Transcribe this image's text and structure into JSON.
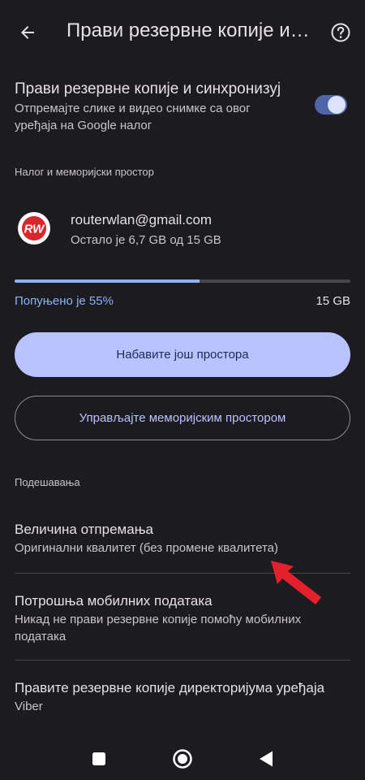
{
  "appbar": {
    "title": "Прави резервне копије и синхронизуј",
    "back_icon": "arrow-back-icon",
    "help_icon": "help-circle-icon"
  },
  "sync": {
    "title": "Прави резервне копије и синхронизуј",
    "description": "Отпремајте слике и видео снимке са овог уређаја на Google налог",
    "enabled": true
  },
  "account_section": {
    "header": "Налог и меморијски простор",
    "avatar_text": "RW",
    "email": "routerwlan@gmail.com",
    "storage_text": "Остало је 6,7 GB од 15 GB",
    "used_fraction": 0.55,
    "used_label": "Попуњено је 55%",
    "total_label": "15 GB"
  },
  "buttons": {
    "get_more": "Набавите још простора",
    "manage": "Управљајте меморијским простором"
  },
  "settings_section": {
    "header": "Подешавања",
    "items": [
      {
        "title": "Величина отпремања",
        "description": "Оригинални квалитет (без промене квалитета)"
      },
      {
        "title": "Потрошња мобилних података",
        "description": "Никад не прави резервне копије помоћу мобилних података"
      },
      {
        "title": "Правите резервне копије директоријума уређаја",
        "description": "Viber"
      }
    ]
  },
  "colors": {
    "accent": "#8ab4f8",
    "primary_button": "#b9c3ff",
    "annotation_arrow": "#e3202b"
  },
  "navbar": {
    "recents_icon": "square-recents-icon",
    "home_icon": "circle-home-icon",
    "back_icon": "triangle-back-icon"
  }
}
